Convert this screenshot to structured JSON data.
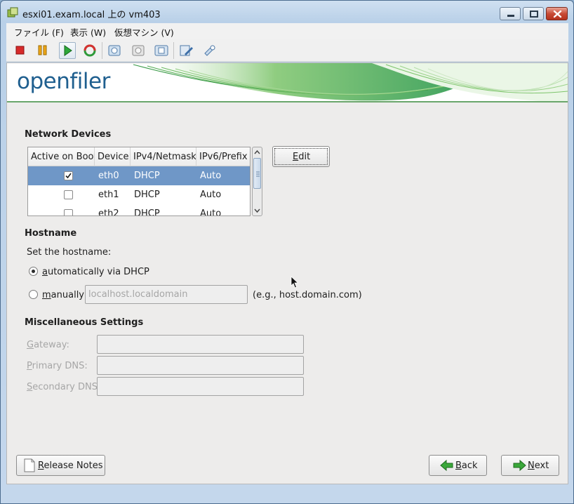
{
  "window": {
    "title": "esxi01.exam.local 上の vm403",
    "icon": "vm-console-icon",
    "controls": [
      "minimize",
      "maximize",
      "close"
    ]
  },
  "menubar": {
    "items": [
      "ファイル (F)",
      "表示 (W)",
      "仮想マシン (V)"
    ]
  },
  "toolbar": {
    "buttons": [
      "stop-icon",
      "pause-icon",
      "play-icon",
      "reset-icon",
      "snapshot-icon",
      "revert-snapshot-icon",
      "manage-snapshots-icon",
      "edit-settings-icon",
      "devices-icon"
    ]
  },
  "banner": {
    "logo": "openfiler"
  },
  "network": {
    "title": "Network Devices",
    "columns": [
      "Active on Boot",
      "Device",
      "IPv4/Netmask",
      "IPv6/Prefix"
    ],
    "rows": [
      {
        "active": true,
        "device": "eth0",
        "ipv4": "DHCP",
        "ipv6": "Auto",
        "selected": true
      },
      {
        "active": false,
        "device": "eth1",
        "ipv4": "DHCP",
        "ipv6": "Auto",
        "selected": false
      },
      {
        "active": false,
        "device": "eth2",
        "ipv4": "DHCP",
        "ipv6": "Auto",
        "selected": false
      }
    ],
    "edit_label": "Edit",
    "edit_mnemonic": "E"
  },
  "hostname": {
    "title": "Hostname",
    "prompt": "Set the hostname:",
    "auto_label": "utomatically via DHCP",
    "auto_mnemonic": "a",
    "manual_label": "anually",
    "manual_mnemonic": "m",
    "manual_placeholder": "localhost.localdomain",
    "example": "(e.g., host.domain.com)",
    "selected": "auto"
  },
  "misc": {
    "title": "Miscellaneous Settings",
    "gateway_label": "ateway:",
    "gateway_mnemonic": "G",
    "primary_dns_label": "rimary DNS:",
    "primary_dns_mnemonic": "P",
    "secondary_dns_label": "econdary DNS:",
    "secondary_dns_mnemonic": "S"
  },
  "footer": {
    "release_notes": "elease Notes",
    "release_notes_mnemonic": "R",
    "back": "ack",
    "back_mnemonic": "B",
    "next": "ext",
    "next_mnemonic": "N"
  },
  "colors": {
    "selection": "#6f97c7",
    "brand": "#1f5f8f",
    "banner_green": "#4caa3c"
  }
}
